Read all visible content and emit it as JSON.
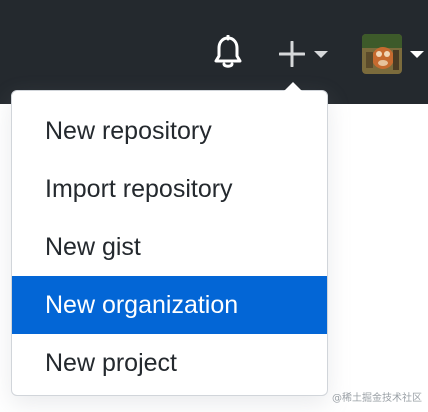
{
  "header": {
    "bell_icon": "bell-icon",
    "plus_icon": "plus-icon",
    "caret_icon": "caret-down-icon",
    "avatar": "avatar"
  },
  "dropdown": {
    "items": [
      {
        "label": "New repository",
        "active": false
      },
      {
        "label": "Import repository",
        "active": false
      },
      {
        "label": "New gist",
        "active": false
      },
      {
        "label": "New organization",
        "active": true
      },
      {
        "label": "New project",
        "active": false
      }
    ]
  },
  "watermark": {
    "text": "@稀土掘金技术社区"
  },
  "colors": {
    "header_bg": "#24292e",
    "active_item_bg": "#0366d6",
    "text": "#24292e"
  }
}
